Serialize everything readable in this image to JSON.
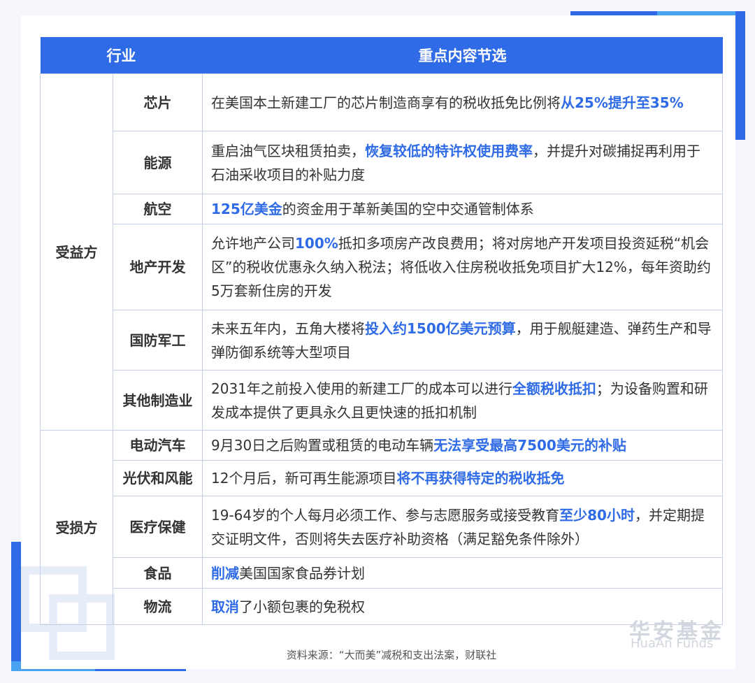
{
  "header": {
    "col_industry": "行业",
    "col_content": "重点内容节选"
  },
  "groups": [
    {
      "label": "受益方",
      "rows": [
        {
          "industry": "芯片",
          "segments": [
            {
              "t": "在美国本土新建工厂的芯片制造商享有的税收抵免比例将"
            },
            {
              "t": "从25%提升至35%",
              "hl": true
            }
          ]
        },
        {
          "industry": "能源",
          "segments": [
            {
              "t": "重启油气区块租赁拍卖，"
            },
            {
              "t": "恢复较低的特许权使用费率",
              "hl": true
            },
            {
              "t": "，并提升对碳捕捉再利用于石油采收项目的补贴力度"
            }
          ]
        },
        {
          "industry": "航空",
          "segments": [
            {
              "t": "125亿美金",
              "hl": true
            },
            {
              "t": "的资金用于革新美国的空中交通管制体系"
            }
          ]
        },
        {
          "industry": "地产开发",
          "segments": [
            {
              "t": "允许地产公司"
            },
            {
              "t": "100%",
              "hl": true
            },
            {
              "t": "抵扣多项房产改良费用；将对房地产开发项目投资延税“机会区”的税收优惠永久纳入税法；将低收入住房税收抵免项目扩大12%，每年资助约5万套新住房的开发"
            }
          ]
        },
        {
          "industry": "国防军工",
          "segments": [
            {
              "t": "未来五年内，五角大楼将"
            },
            {
              "t": "投入约1500亿美元预算",
              "hl": true
            },
            {
              "t": "，用于舰艇建造、弹药生产和导弹防御系统等大型项目"
            }
          ]
        },
        {
          "industry": "其他制造业",
          "segments": [
            {
              "t": "2031年之前投入使用的新建工厂的成本可以进行"
            },
            {
              "t": "全额税收抵扣",
              "hl": true
            },
            {
              "t": "；为设备购置和研发成本提供了更具永久且更快速的抵扣机制"
            }
          ]
        }
      ]
    },
    {
      "label": "受损方",
      "rows": [
        {
          "industry": "电动汽车",
          "segments": [
            {
              "t": "9月30日之后购置或租赁的电动车辆"
            },
            {
              "t": "无法享受最高7500美元的补贴",
              "hl": true
            }
          ]
        },
        {
          "industry": "光伏和风能",
          "segments": [
            {
              "t": "12个月后，新可再生能源项目"
            },
            {
              "t": "将不再获得特定的税收抵免",
              "hl": true
            }
          ]
        },
        {
          "industry": "医疗保健",
          "segments": [
            {
              "t": "19-64岁的个人每月必须工作、参与志愿服务或接受教育"
            },
            {
              "t": "至少80小时",
              "hl": true
            },
            {
              "t": "，并定期提交证明文件，否则将失去医疗补助资格（满足豁免条件除外）"
            }
          ]
        },
        {
          "industry": "食品",
          "segments": [
            {
              "t": "削减",
              "hl": true
            },
            {
              "t": "美国国家食品券计划"
            }
          ]
        },
        {
          "industry": "物流",
          "segments": [
            {
              "t": "取消",
              "hl": true
            },
            {
              "t": "了小额包裹的免税权"
            }
          ]
        }
      ]
    }
  ],
  "footer": {
    "source": "资料来源：“大而美”减税和支出法案，财联社"
  },
  "watermark": {
    "cn": "华安基金",
    "en": "HuaAn Funds"
  },
  "colors": {
    "accent": "#2f6be6",
    "accent_light": "#4aa3f0",
    "border": "#c5d0e8"
  }
}
